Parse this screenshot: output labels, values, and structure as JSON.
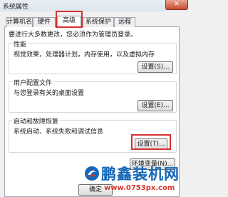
{
  "window": {
    "title": "系统属性",
    "close_symbol": "✕"
  },
  "tabs": [
    {
      "label": "计算机名",
      "active": false
    },
    {
      "label": "硬件",
      "active": false
    },
    {
      "label": "高级",
      "active": true
    },
    {
      "label": "系统保护",
      "active": false
    },
    {
      "label": "远程",
      "active": false
    }
  ],
  "admin_note": "要进行大多数更改，您必须作为管理员登录。",
  "performance": {
    "title": "性能",
    "description": "视觉效果，处理器计划，内存使用，以及虚拟内存",
    "button": "设置(S)..."
  },
  "user_profiles": {
    "title": "用户配置文件",
    "description": "与您登录有关的桌面设置",
    "button": "设置(E)..."
  },
  "startup_recovery": {
    "title": "启动和故障恢复",
    "description": "系统启动、系统失败和调试信息",
    "button": "设置(T)..."
  },
  "env_button": "环境变量(N)...",
  "ok_button": "确定",
  "watermark": {
    "text": "鹏鑫装机网",
    "url": "www.0753px.com"
  },
  "colors": {
    "highlight": "#d63131",
    "watermark_blue": "#1467b8",
    "watermark_red": "#d6382c"
  }
}
